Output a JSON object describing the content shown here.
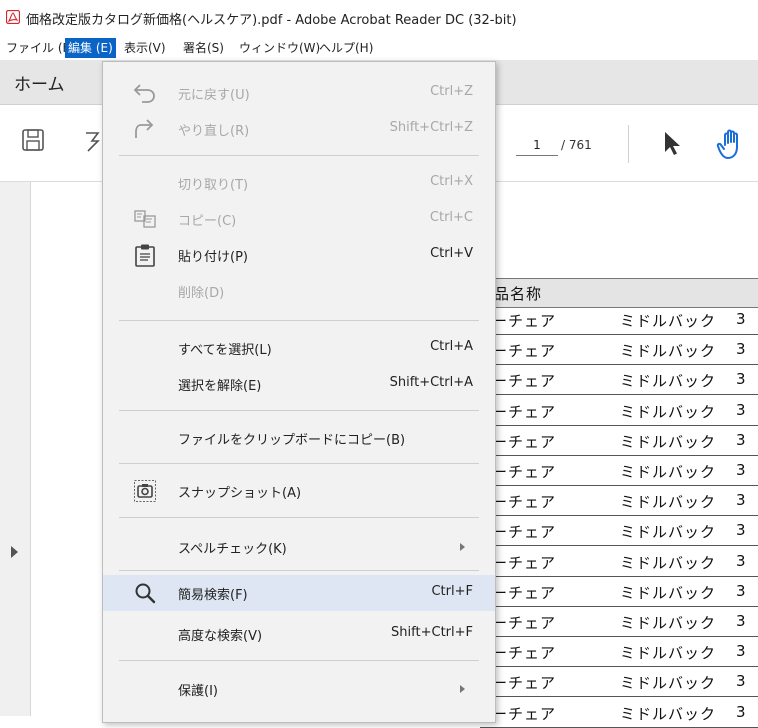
{
  "window": {
    "title": "価格改定版カタログ新価格(ヘルスケア).pdf - Adobe Acrobat Reader DC (32-bit)",
    "logo_icon": "acrobat-pdf-icon",
    "accent": "#d7262e"
  },
  "menubar": {
    "items": [
      {
        "label": "ファイル (F)"
      },
      {
        "label": "編集 (E)"
      },
      {
        "label": "表示(V)"
      },
      {
        "label": "署名(S)"
      },
      {
        "label": "ウィンドウ(W)"
      },
      {
        "label": "ヘルプ(H)"
      }
    ],
    "active_color": "#0a64c8"
  },
  "tabs": {
    "home": "ホーム"
  },
  "toolbar": {
    "current_page": "1",
    "page_separator": "/ 761"
  },
  "edit_menu": {
    "items": [
      {
        "label": "元に戻す(U)",
        "shortcut": "Ctrl+Z",
        "icon": "undo-icon",
        "enabled": false
      },
      {
        "label": "やり直し(R)",
        "shortcut": "Shift+Ctrl+Z",
        "icon": "redo-icon",
        "enabled": false
      },
      {
        "label": "切り取り(T)",
        "shortcut": "Ctrl+X",
        "enabled": false
      },
      {
        "label": "コピー(C)",
        "shortcut": "Ctrl+C",
        "icon": "copy-icon",
        "enabled": false
      },
      {
        "label": "貼り付け(P)",
        "shortcut": "Ctrl+V",
        "icon": "clipboard-icon",
        "enabled": true
      },
      {
        "label": "削除(D)",
        "shortcut": "",
        "enabled": false
      },
      {
        "label": "すべてを選択(L)",
        "shortcut": "Ctrl+A",
        "enabled": true
      },
      {
        "label": "選択を解除(E)",
        "shortcut": "Shift+Ctrl+A",
        "enabled": true
      },
      {
        "label": "ファイルをクリップボードにコピー(B)",
        "shortcut": "",
        "enabled": true
      },
      {
        "label": "スナップショット(A)",
        "shortcut": "",
        "icon": "camera-icon",
        "enabled": true
      },
      {
        "label": "スペルチェック(K)",
        "shortcut": "",
        "submenu": true,
        "enabled": true
      },
      {
        "label": "簡易検索(F)",
        "shortcut": "Ctrl+F",
        "icon": "search-icon",
        "enabled": true,
        "highlighted": true
      },
      {
        "label": "高度な検索(V)",
        "shortcut": "Shift+Ctrl+F",
        "enabled": true
      },
      {
        "label": "保護(I)",
        "shortcut": "",
        "submenu": true,
        "enabled": true
      }
    ],
    "highlight_color": "#dde6f2"
  },
  "document": {
    "header": "品名称",
    "rows": [
      {
        "a": "ーチェア",
        "b": "ミドルバック",
        "c": "3"
      },
      {
        "a": "ーチェア",
        "b": "ミドルバック",
        "c": "3"
      },
      {
        "a": "ーチェア",
        "b": "ミドルバック",
        "c": "3"
      },
      {
        "a": "ーチェア",
        "b": "ミドルバック",
        "c": "3"
      },
      {
        "a": "ーチェア",
        "b": "ミドルバック",
        "c": "3"
      },
      {
        "a": "ーチェア",
        "b": "ミドルバック",
        "c": "3"
      },
      {
        "a": "ーチェア",
        "b": "ミドルバック",
        "c": "3"
      },
      {
        "a": "ーチェア",
        "b": "ミドルバック",
        "c": "3"
      },
      {
        "a": "ーチェア",
        "b": "ミドルバック",
        "c": "3"
      },
      {
        "a": "ーチェア",
        "b": "ミドルバック",
        "c": "3"
      },
      {
        "a": "ーチェア",
        "b": "ミドルバック",
        "c": "3"
      },
      {
        "a": "ーチェア",
        "b": "ミドルバック",
        "c": "3"
      },
      {
        "a": "ーチェア",
        "b": "ミドルバック",
        "c": "3"
      },
      {
        "a": "ーチェア",
        "b": "ミドルバック",
        "c": "3"
      }
    ]
  }
}
